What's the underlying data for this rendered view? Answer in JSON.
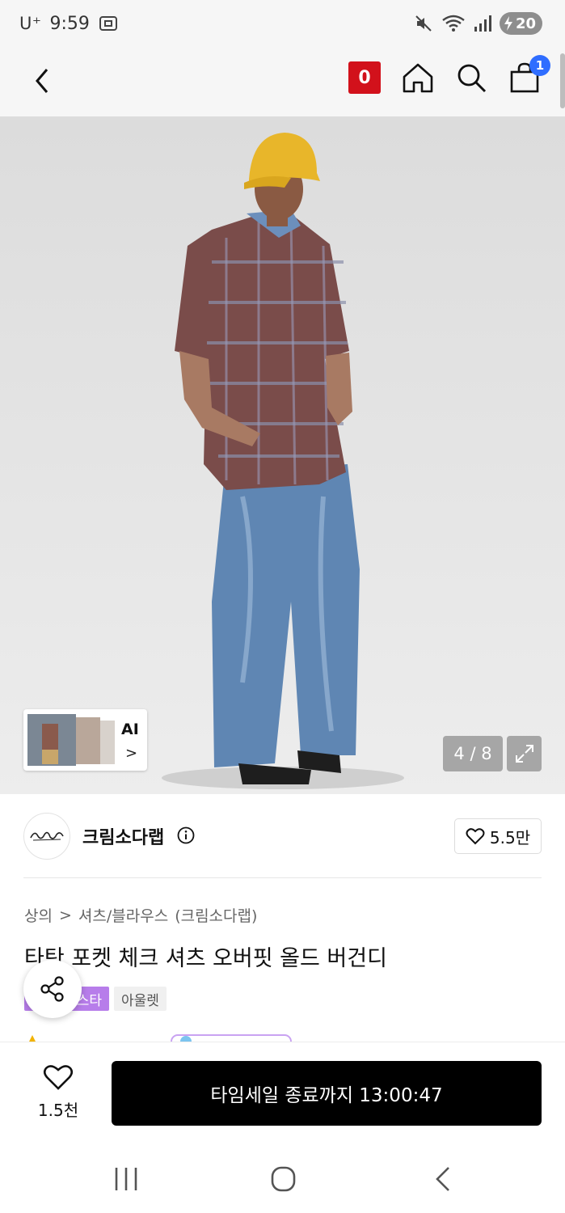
{
  "status_bar": {
    "carrier": "U⁺",
    "time": "9:59",
    "battery": "20"
  },
  "header": {
    "brand_badge": "0",
    "cart_count": "1"
  },
  "gallery": {
    "ai_label": "AI",
    "ai_chevron": ">",
    "pager": "4 / 8"
  },
  "brand": {
    "name": "크림소다랩",
    "like_count": "5.5만"
  },
  "product": {
    "breadcrumb": [
      "상의",
      ">",
      "셔츠/블라우스",
      "(크림소다랩)"
    ],
    "title": "타탄 포켓 체크 셔츠 오버핏 올드 버건디",
    "tags": [
      "스타",
      "아울렛"
    ]
  },
  "bottom_bar": {
    "like_count": "1.5천",
    "cta_label": "타임세일 종료까지 13:00:47"
  },
  "colors": {
    "brand_badge": "#d2111b",
    "cart_badge": "#2f6dff",
    "tag_purple": "#b77dea",
    "cta_bg": "#000000"
  },
  "icons": [
    "back-icon",
    "home-icon",
    "search-icon",
    "cart-icon",
    "expand-icon",
    "info-icon",
    "heart-icon",
    "share-icon",
    "recent-apps-icon",
    "home-nav-icon",
    "back-nav-icon"
  ]
}
